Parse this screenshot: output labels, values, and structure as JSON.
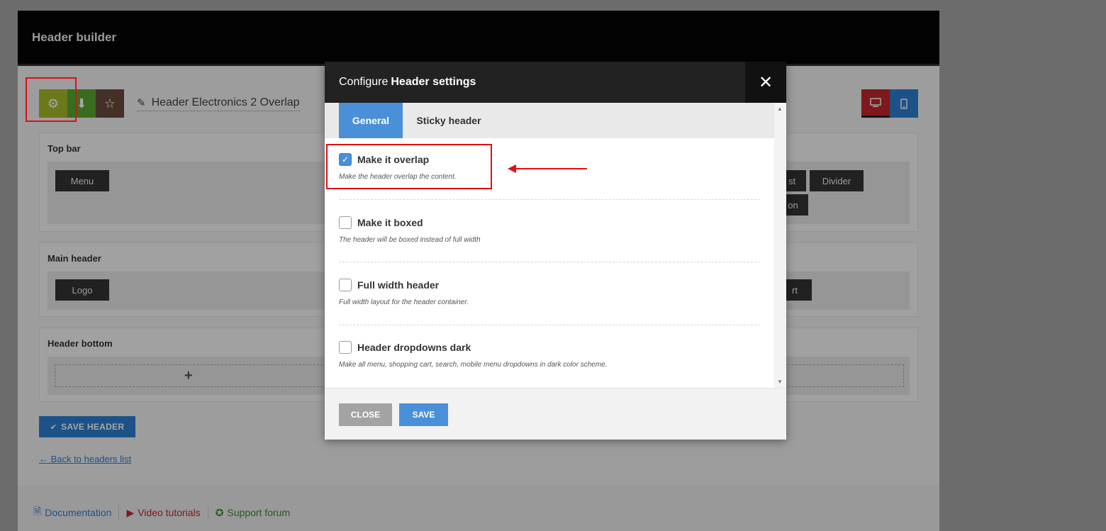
{
  "page": {
    "title": "Header builder",
    "header_name": "Header Electronics 2 Overlap",
    "toolbar": {
      "settings_icon": "gear-icon",
      "import_icon": "download-icon",
      "favorite_icon": "star-icon",
      "edit_icon": "pencil-icon"
    },
    "device_buttons": {
      "desktop_icon": "desktop-icon",
      "mobile_icon": "mobile-icon"
    },
    "rows": [
      {
        "label": "Top bar",
        "left_chip": "Menu",
        "right_chips": [
          "st",
          "Divider",
          "on"
        ]
      },
      {
        "label": "Main header",
        "left_chip": "Logo",
        "right_chips": [
          "rt"
        ]
      },
      {
        "label": "Header bottom",
        "add": "+"
      }
    ],
    "save_header": "SAVE HEADER",
    "back_link": "← Back to headers list",
    "footer": {
      "documentation": "Documentation",
      "video_tutorials": "Video tutorials",
      "support_forum": "Support forum"
    }
  },
  "modal": {
    "title_prefix": "Configure",
    "title_bold": "Header settings",
    "close_symbol": "✕",
    "tabs": [
      "General",
      "Sticky header"
    ],
    "options": [
      {
        "label": "Make it overlap",
        "description": "Make the header overlap the content.",
        "checked": true
      },
      {
        "label": "Make it boxed",
        "description": "The header will be boxed instead of full width",
        "checked": false
      },
      {
        "label": "Full width header",
        "description": "Full width layout for the header container.",
        "checked": false
      },
      {
        "label": "Header dropdowns dark",
        "description": "Make all menu, shopping cart, search, mobile menu dropdowns in dark color scheme.",
        "checked": false
      }
    ],
    "buttons": {
      "close": "CLOSE",
      "save": "SAVE"
    }
  },
  "colors": {
    "accent_blue": "#4a90d9",
    "annotation_red": "#e01010",
    "modal_header": "#222222"
  }
}
